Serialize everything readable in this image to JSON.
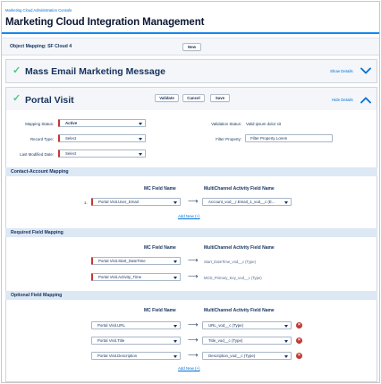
{
  "header": {
    "breadcrumb": "Marketing Cloud Administration Console",
    "title": "Marketing Cloud Integration Management"
  },
  "object_mapping": {
    "label": "Object Mapping: SF Cloud 4",
    "new_button": "New"
  },
  "mass_email": {
    "title": "Mass Email Marketing Message",
    "toggle": "Show Details"
  },
  "portal_visit": {
    "title": "Portal Visit",
    "validate_button": "Validate",
    "cancel_button": "Cancel",
    "save_button": "Save",
    "toggle": "Hide Details",
    "mapping_status_label": "Mapping Status:",
    "mapping_status_value": "Active",
    "record_type_label": "Record Type:",
    "record_type_value": "Select",
    "last_modified_label": "Last Modified Date:",
    "last_modified_value": "Select",
    "validation_status_label": "Validation Status:",
    "validation_status_value": "Valid ipsum dolor sit",
    "filter_property_label": "Filter Property:",
    "filter_property_value": "Filter Property Lorem"
  },
  "contact_account": {
    "section_title": "Contact-Account Mapping",
    "col_mc": "MC Field Name",
    "col_mca": "MultiChannel Activity Field Name",
    "rows": [
      {
        "num": "1.",
        "mc": "Portal Visit.User_Email",
        "mca": "Account_vod__r.Email_1_vod__c (E..."
      }
    ],
    "add_new": "Add New (+)"
  },
  "required": {
    "section_title": "Required Field Mapping",
    "col_mc": "MC Field Name",
    "col_mca": "MultiChannel Activity Field Name",
    "rows": [
      {
        "mc": "Portal Visit.Start_DateTime",
        "mca": "Start_DateTime_vod__c (Type)"
      },
      {
        "mc": "Portal Visit.Activity_Time",
        "mca": "MCD_Primary_Key_vod__c (Type)"
      }
    ]
  },
  "optional": {
    "section_title": "Optional Field Mapping",
    "col_mc": "MC Field Name",
    "col_mca": "MultiChannel Activity Field Name",
    "rows": [
      {
        "mc": "Portal Visit.URL",
        "mca": "URL_vod__c (Type)"
      },
      {
        "mc": "Portal Visit.Title",
        "mca": "Title_vod__c (Type)"
      },
      {
        "mc": "Portal Visit.Description",
        "mca": "Description_vod__c (Type)"
      }
    ],
    "add_new": "Add New (+)"
  },
  "glyphs": {
    "check": "✓",
    "arrow": "⟶",
    "delete": "×"
  },
  "colors": {
    "accent": "#0070d2",
    "success": "#4bca81",
    "error": "#c23934",
    "section_bg": "#dde8f5",
    "required_marker": "#c23934"
  }
}
